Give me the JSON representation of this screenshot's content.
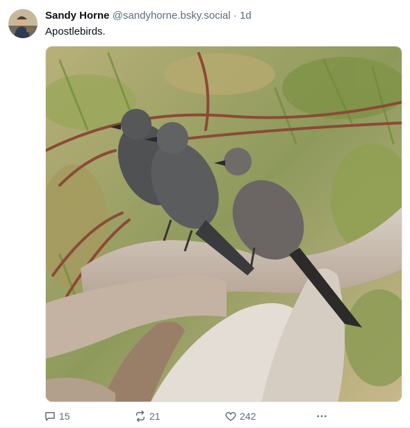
{
  "post": {
    "author": {
      "display_name": "Sandy Horne",
      "handle": "@sandyhorne.bsky.social"
    },
    "separator": "·",
    "timestamp": "1d",
    "text": "Apostlebirds.",
    "image": {
      "subject": "apostlebirds perched on a eucalyptus branch"
    },
    "stats": {
      "replies": "15",
      "reposts": "21",
      "likes": "242"
    }
  },
  "icons": {
    "reply": "reply-icon",
    "repost": "repost-icon",
    "like": "heart-icon",
    "more": "more-icon"
  },
  "colors": {
    "muted_text": "#5d6b7c",
    "primary_text": "#0b0f14",
    "border": "#e6ebf0"
  }
}
